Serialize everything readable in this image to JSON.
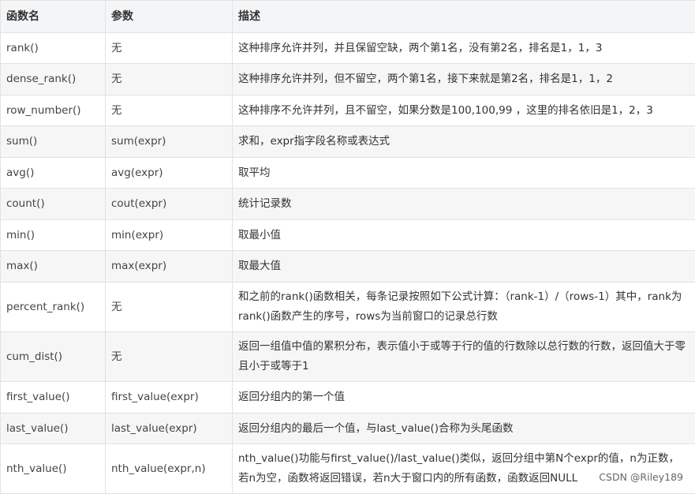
{
  "table": {
    "headers": [
      "函数名",
      "参数",
      "描述"
    ],
    "rows": [
      {
        "fn": "rank()",
        "param": "无",
        "desc": "这种排序允许并列，并且保留空缺，两个第1名，没有第2名，排名是1，1，3",
        "h": 39
      },
      {
        "fn": "dense_rank()",
        "param": "无",
        "desc": "这种排序允许并列，但不留空，两个第1名，接下来就是第2名，排名是1，1，2",
        "h": 40
      },
      {
        "fn": "row_number()",
        "param": "无",
        "desc": "这种排序不允许并列，且不留空，如果分数是100,100,99 ，这里的排名依旧是1，2，3",
        "h": 39
      },
      {
        "fn": "sum()",
        "param": "sum(expr)",
        "desc": "求和，expr指字段名称或表达式",
        "h": 40
      },
      {
        "fn": "avg()",
        "param": "avg(expr)",
        "desc": "取平均",
        "h": 39
      },
      {
        "fn": "count()",
        "param": "cout(expr)",
        "desc": "统计记录数",
        "h": 40
      },
      {
        "fn": "min()",
        "param": "min(expr)",
        "desc": "取最小值",
        "h": 39
      },
      {
        "fn": "max()",
        "param": "max(expr)",
        "desc": "取最大值",
        "h": 40
      },
      {
        "fn": "percent_rank()",
        "param": "无",
        "desc": "和之前的rank()函数相关，每条记录按照如下公式计算：（rank-1）/（rows-1）其中，rank为rank()函数产生的序号，rows为当前窗口的记录总行数",
        "h": 63
      },
      {
        "fn": "cum_dist()",
        "param": "无",
        "desc": "返回一组值中值的累积分布，表示值小于或等于行的值的行数除以总行数的行数，返回值大于零且小于或等于1",
        "h": 63
      },
      {
        "fn": "first_value()",
        "param": "first_value(expr)",
        "desc": "返回分组内的第一个值",
        "h": 40
      },
      {
        "fn": "last_value()",
        "param": "last_value(expr)",
        "desc": "返回分组内的最后一个值，与last_value()合称为头尾函数",
        "h": 39
      },
      {
        "fn": "nth_value()",
        "param": "nth_value(expr,n)",
        "desc": "nth_value()功能与first_value()/last_value()类似，返回分组中第N个expr的值，n为正数，若n为空，函数将返回错误，若n大于窗口内的所有函数，函数返回NULL",
        "h": 63
      }
    ]
  },
  "watermark": "CSDN @Riley189"
}
